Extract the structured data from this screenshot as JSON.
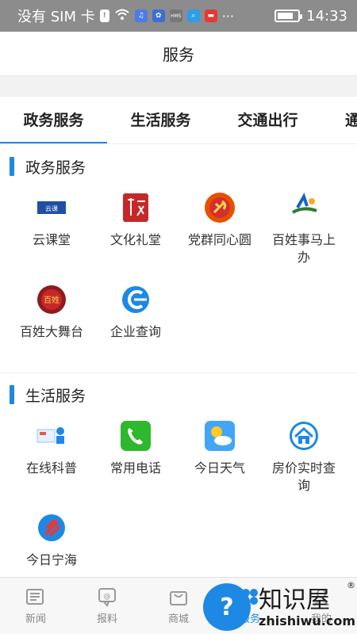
{
  "status_bar": {
    "carrier": "没有 SIM 卡",
    "time": "14:33",
    "battery_level": 0.8,
    "notification_icons": [
      "alert-icon",
      "wifi-icon",
      "music-icon",
      "baidu-icon",
      "hms-icon",
      "search-app-icon",
      "huawei-icon",
      "more-icon"
    ],
    "hms_label": "HMS"
  },
  "header": {
    "title": "服务"
  },
  "tabs": [
    {
      "label": "政务服务",
      "active": true
    },
    {
      "label": "生活服务",
      "active": false
    },
    {
      "label": "交通出行",
      "active": false
    },
    {
      "label": "通",
      "active": false
    }
  ],
  "sections": [
    {
      "title": "政务服务",
      "items": [
        {
          "label": "云课堂",
          "icon": "cloud-classroom-icon"
        },
        {
          "label": "文化礼堂",
          "icon": "culture-hall-icon"
        },
        {
          "label": "党群同心圆",
          "icon": "party-emblem-icon"
        },
        {
          "label": "百姓事马上办",
          "icon": "citizen-affairs-icon"
        },
        {
          "label": "百姓大舞台",
          "icon": "stage-icon"
        },
        {
          "label": "企业查询",
          "icon": "enterprise-search-icon"
        }
      ]
    },
    {
      "title": "生活服务",
      "items": [
        {
          "label": "在线科普",
          "icon": "science-icon"
        },
        {
          "label": "常用电话",
          "icon": "phone-icon"
        },
        {
          "label": "今日天气",
          "icon": "weather-icon"
        },
        {
          "label": "房价实时查询",
          "icon": "house-icon"
        },
        {
          "label": "今日宁海",
          "icon": "ninghai-icon"
        }
      ]
    }
  ],
  "bottom_nav": [
    {
      "label": "新闻",
      "icon": "news-icon",
      "active": false
    },
    {
      "label": "报料",
      "icon": "report-icon",
      "active": false
    },
    {
      "label": "商城",
      "icon": "shop-icon",
      "active": false
    },
    {
      "label": "服务",
      "icon": "service-icon",
      "active": true
    },
    {
      "label": "我的",
      "icon": "profile-icon",
      "active": false
    }
  ],
  "watermark": {
    "title": "知识屋",
    "url": "zhishiwu.com",
    "reg_mark": "®",
    "badge": "?"
  },
  "colors": {
    "accent": "#1e88e5",
    "status_bar": "#8c8c8c"
  }
}
